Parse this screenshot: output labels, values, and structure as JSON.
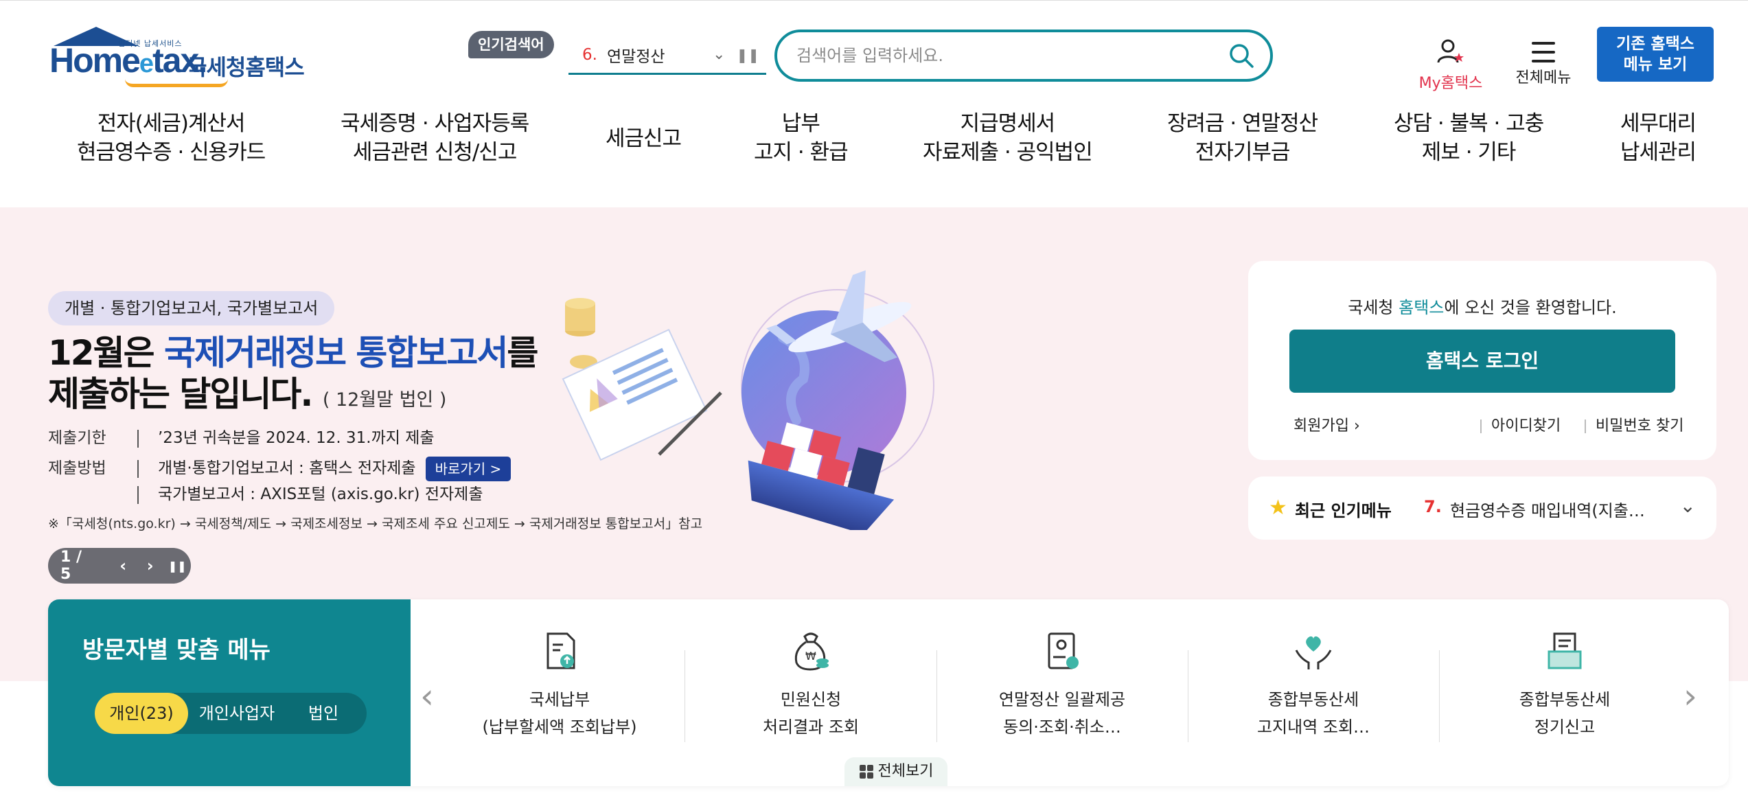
{
  "header": {
    "logo": {
      "sub": "인터넷 납세서비스",
      "brand": "Home",
      "brand_e": "e",
      "brand_tail": "tax.",
      "korean": "국세청홈택스"
    },
    "popular": {
      "badge": "인기검색어",
      "rank": "6.",
      "term": "연말정산"
    },
    "search": {
      "placeholder": "검색어를 입력하세요."
    },
    "my_hometax": "My홈택스",
    "all_menu": "전체메뉴",
    "legacy_button": [
      "기존 홈택스",
      "메뉴 보기"
    ]
  },
  "gnb": [
    [
      "전자(세금)계산서",
      "현금영수증 · 신용카드"
    ],
    [
      "국세증명 · 사업자등록",
      "세금관련 신청/신고"
    ],
    [
      "세금신고"
    ],
    [
      "납부",
      "고지 · 환급"
    ],
    [
      "지급명세서",
      "자료제출 · 공익법인"
    ],
    [
      "장려금 · 연말정산",
      "전자기부금"
    ],
    [
      "상담 · 불복 · 고충",
      "제보 · 기타"
    ],
    [
      "세무대리",
      "납세관리"
    ]
  ],
  "hero": {
    "tag": "개별 · 통합기업보고서, 국가별보고서",
    "title_pre": "12월은 ",
    "title_hl": "국제거래정보 통합보고서",
    "title_post": "를",
    "title_line2": "제출하는 달입니다.",
    "title_note": "( 12월말 법인 )",
    "deadline_label": "제출기한",
    "deadline_text": "’23년 귀속분을 2024. 12. 31.까지 제출",
    "method_label": "제출방법",
    "method_line1": "개별·통합기업보고서 : 홈택스 전자제출",
    "goto_button": "바로가기 >",
    "method_line2": "국가별보고서 : AXIS포털 (axis.go.kr) 전자제출",
    "footnote": "※「국세청(nts.go.kr) → 국세정책/제도 → 국제조세정보 → 국제조세 주요 신고제도 → 국제거래정보 통합보고서」참고",
    "slide_counter": "1 / 5"
  },
  "login": {
    "welcome_pre": "국세청 ",
    "welcome_hl": "홈택스",
    "welcome_post": "에 오신 것을 환영합니다.",
    "login_button": "홈택스 로그인",
    "join": "회원가입",
    "find_id": "아이디찾기",
    "find_pw": "비밀번호 찾기"
  },
  "recent": {
    "title": "최근 인기메뉴",
    "rank": "7.",
    "text": "현금영수증 매입내역(지출…"
  },
  "visitor": {
    "title": "방문자별 맞춤 메뉴",
    "tabs": [
      "개인(23)",
      "개인사업자",
      "법인"
    ],
    "services": [
      {
        "icon": "tax-payment-icon",
        "l1": "국세납부",
        "l2": "(납부할세액 조회납부)"
      },
      {
        "icon": "money-bag-icon",
        "l1": "민원신청",
        "l2": "처리결과 조회"
      },
      {
        "icon": "document-seal-icon",
        "l1": "연말정산 일괄제공",
        "l2": "동의·조회·취소…"
      },
      {
        "icon": "heart-hands-icon",
        "l1": "종합부동산세",
        "l2": "고지내역 조회…"
      },
      {
        "icon": "folder-doc-icon",
        "l1": "종합부동산세",
        "l2": "정기신고"
      }
    ],
    "view_all": "전체보기"
  },
  "colors": {
    "teal": "#0f8690",
    "hero_bg": "#fbeff1",
    "accent_red": "#e63232",
    "legacy_blue": "#1668c4",
    "highlight_blue": "#1d4fb5",
    "tab_yellow": "#f7d948"
  }
}
